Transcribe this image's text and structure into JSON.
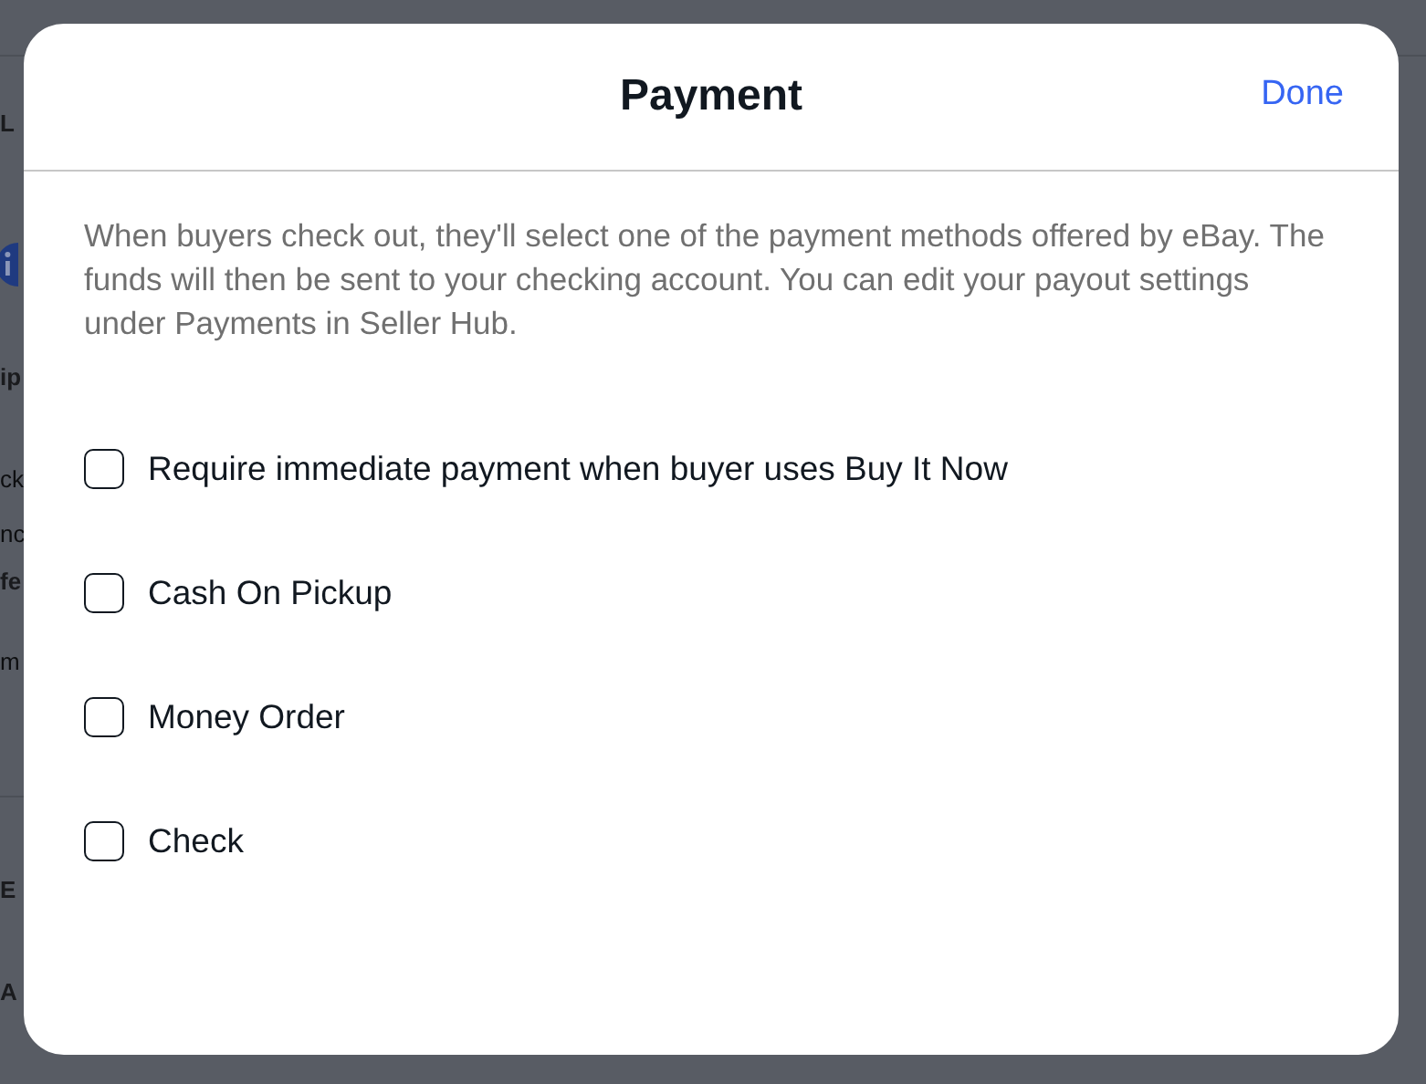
{
  "background_page": {
    "fragments": [
      {
        "kind": "heading",
        "text": "L"
      },
      {
        "kind": "info"
      },
      {
        "kind": "heading",
        "text": "ip"
      },
      {
        "kind": "body",
        "text": "ck"
      },
      {
        "kind": "body",
        "text": "nc"
      },
      {
        "kind": "heading",
        "text": "fe"
      },
      {
        "kind": "body",
        "text": "m"
      },
      {
        "kind": "divider"
      },
      {
        "kind": "heading",
        "text": "E"
      },
      {
        "kind": "heading",
        "text": "A"
      }
    ]
  },
  "dialog": {
    "title": "Payment",
    "done_button": "Done",
    "description": "When buyers check out, they'll select one of the payment methods offered by eBay. The funds will then be sent to your checking account. You can edit your payout settings under Payments in Seller Hub.",
    "options": [
      {
        "label": "Require immediate payment when buyer uses Buy It Now",
        "checked": false
      },
      {
        "label": "Cash On Pickup",
        "checked": false
      },
      {
        "label": "Money Order",
        "checked": false
      },
      {
        "label": "Check",
        "checked": false
      }
    ]
  }
}
